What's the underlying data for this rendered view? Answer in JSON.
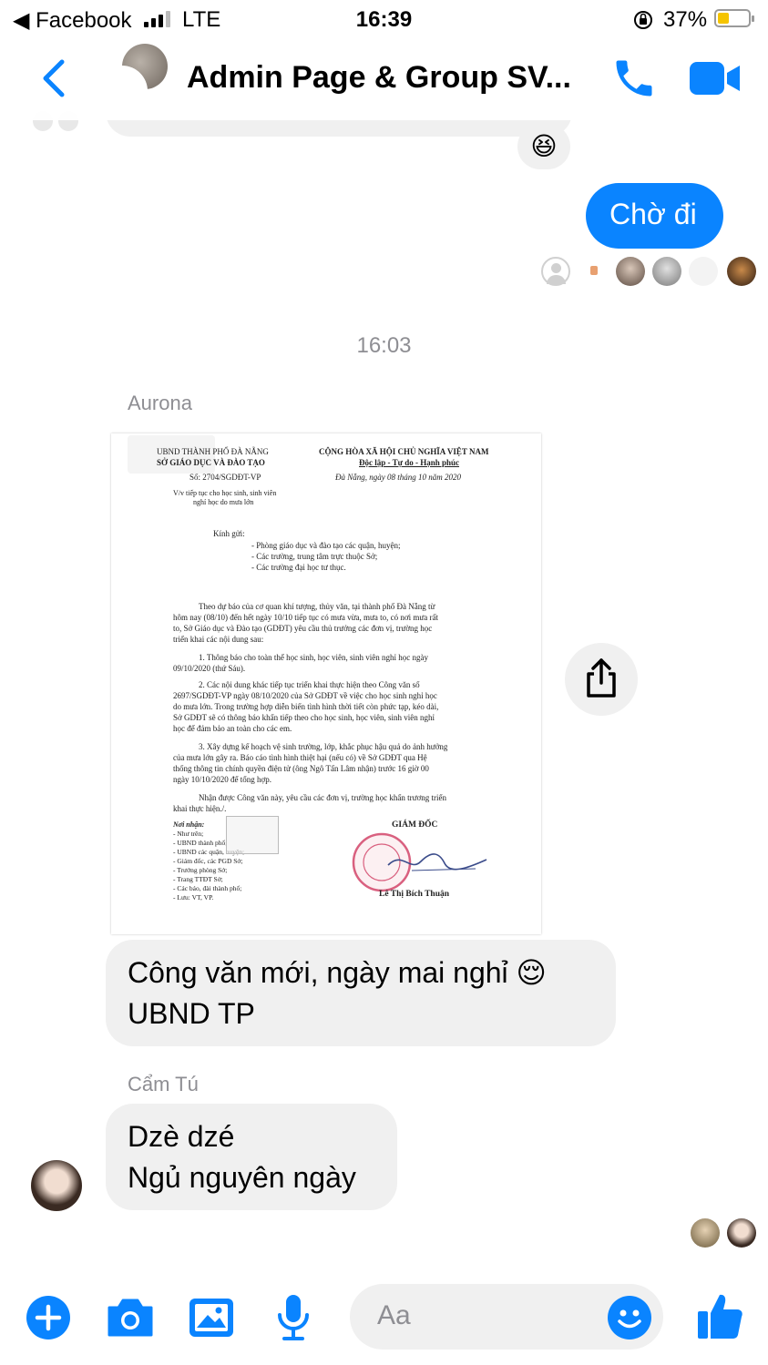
{
  "status_bar": {
    "back_app": "◀ Facebook",
    "network": "LTE",
    "time": "16:39",
    "battery_pct": "37%",
    "battery_level": 0.37
  },
  "header": {
    "title": "Admin Page & Group SV...",
    "accent": "#0a84ff"
  },
  "messages": {
    "reaction_emoji": "😆",
    "outgoing_text": "Chờ đi",
    "time_divider": "16:03",
    "sender1": "Aurona",
    "msg1_line1": "Công văn mới, ngày mai nghỉ 😌",
    "msg1_line2": "UBND TP",
    "sender2": "Cẩm Tú",
    "msg2_line1": "Dzè dzé",
    "msg2_line2": "Ngủ nguyên ngày"
  },
  "document": {
    "left_h1": "UBND THÀNH PHỐ ĐÀ NẴNG",
    "left_h2": "SỞ GIÁO DỤC VÀ ĐÀO TẠO",
    "doc_no": "Số: 2704/SGDĐT-VP",
    "subject1": "V/v tiếp tục cho học sinh, sinh viên",
    "subject2": "nghỉ học do mưa lớn",
    "right_h1": "CỘNG HÒA XÃ HỘI CHỦ NGHĨA VIỆT NAM",
    "right_h2": "Độc lập - Tự do - Hạnh phúc",
    "date": "Đà Nẵng, ngày 08  tháng 10 năm 2020",
    "kinh_gui": "Kính gửi:",
    "to1": "- Phòng giáo dục và đào tạo các quận, huyện;",
    "to2": "- Các trường, trung tâm trực thuộc Sở;",
    "to3": "- Các trường đại học tư thục.",
    "p1": "Theo dự báo của cơ quan khí tượng, thủy văn, tại thành phố Đà Nẵng từ",
    "p2": "hôm nay (08/10) đến hết ngày 10/10 tiếp tục có mưa vừa, mưa to, có nơi mưa rất",
    "p3": "to, Sở Giáo dục và Đào tạo (GDĐT) yêu cầu thủ trưởng các đơn vị, trường học",
    "p4": "triển khai các nội dung sau:",
    "p5": "1. Thông báo cho toàn thể học sinh, học viên, sinh viên nghỉ học ngày",
    "p6": "09/10/2020 (thứ Sáu).",
    "p7": "2. Các nội dung khác tiếp tục triển khai thực hiện theo Công văn số",
    "p8": "2697/SGDĐT-VP ngày 08/10/2020 của Sở GDĐT về việc cho học sinh nghỉ học",
    "p9": "do mưa lớn. Trong trường hợp diễn biến tình hình thời tiết còn phức tạp, kéo dài,",
    "p10": "Sở GDĐT sẽ có thông báo khẩn tiếp theo cho học sinh, học viên, sinh viên nghỉ",
    "p11": "học để đảm bảo an toàn cho các em.",
    "p12": "3. Xây dựng kế hoạch vệ sinh trường, lớp, khắc phục hậu quả do ảnh hưởng",
    "p13": "của mưa lớn gây ra. Báo cáo tình hình thiệt hại (nếu có) về Sở GDĐT qua Hệ",
    "p14": "thống thông tin chính quyền điện tử (ông Ngô Tấn Lâm nhận) trước 16 giờ 00",
    "p15": "ngày 10/10/2020 để tổng hợp.",
    "p16": "Nhận được Công văn này, yêu cầu các đơn vị, trường học khẩn trương triển",
    "p17": "khai thực hiện./.",
    "noi_nhan": "Nơi nhận:",
    "r1": "- Như trên;",
    "r2": "- UBND thành phố;",
    "r3": "- UBND các quận, huyện;",
    "r4": "- Giám đốc, các PGD Sở;",
    "r5": "- Trưởng phòng Sở;",
    "r6": "- Trang TTĐT Sở;",
    "r7": "- Các báo, đài thành phố;",
    "r8": "- Lưu: VT, VP.",
    "giam_doc": "GIÁM ĐỐC",
    "signer": "Lê Thị Bích Thuận"
  },
  "composer": {
    "placeholder": "Aa"
  }
}
